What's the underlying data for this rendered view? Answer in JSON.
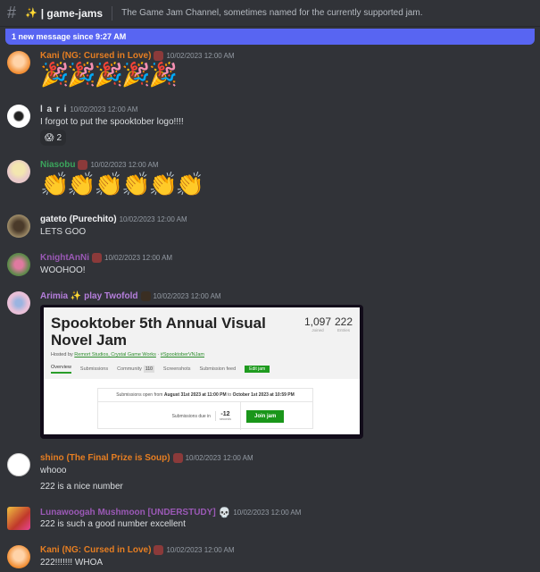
{
  "channel": {
    "name": "| game-jams",
    "topic": "The Game Jam Channel, sometimes named for the currently supported jam."
  },
  "new_messages_bar": "1 new message since 9:27 AM",
  "messages": [
    {
      "username": "Kani (NG: Cursed in Love)",
      "color": "#e67e22",
      "timestamp": "10/02/2023 12:00 AM",
      "emoji": "🎉🎉🎉🎉🎉",
      "avatar_color": "#f5a24a"
    },
    {
      "username": "l a r i",
      "color": "#dbdee1",
      "timestamp": "10/02/2023 12:00 AM",
      "text": "I forgot to put the spooktober logo!!!!",
      "reaction": {
        "emoji": "😱",
        "count": "2"
      },
      "avatar_color": "#eeeeee"
    },
    {
      "username": "Niasobu",
      "color": "#3ba55c",
      "timestamp": "10/02/2023 12:00 AM",
      "emoji": "👏👏👏👏👏👏",
      "avatar_color": "#d9c9c2"
    },
    {
      "username": "gateto (Purechito)",
      "color": "#dbdee1",
      "timestamp": "10/02/2023 12:00 AM",
      "text": "LETS GOO",
      "avatar_color": "#6b5b45"
    },
    {
      "username": "KnightAnNi",
      "color": "#9b59b6",
      "timestamp": "10/02/2023 12:00 AM",
      "text": "WOOHOO!",
      "avatar_color": "#7a9a6a"
    },
    {
      "username": "Arimia ✨ play Twofold",
      "color": "#b57edc",
      "timestamp": "10/02/2023 12:00 AM",
      "avatar_color": "#d8b8d8"
    },
    {
      "username": "shino (The Final Prize is Soup)",
      "color": "#e67e22",
      "timestamp": "10/02/2023 12:00 AM",
      "lines": [
        "whooo",
        "222 is a nice number"
      ],
      "avatar_color": "#ffffff"
    },
    {
      "username": "Lunawoogah Mushmoon [UNDERSTUDY]",
      "color": "#9b59b6",
      "timestamp": "10/02/2023 12:00 AM",
      "text": "222 is such a good number excellent",
      "avatar_color": "#c0392b"
    },
    {
      "username": "Kani (NG: Cursed in Love)",
      "color": "#e67e22",
      "timestamp": "10/02/2023 12:00 AM",
      "text": "222!!!!!!! WHOA",
      "avatar_color": "#f5a24a"
    }
  ],
  "embed": {
    "title": "Spooktober 5th Annual Visual Novel Jam",
    "hosted_by_prefix": "Hosted by ",
    "hosts": "Remort Studios, Crystal Game Works",
    "hashtag": "#SpooktoberVNJam",
    "joined": "1,097",
    "joined_label": "Joined",
    "entries": "222",
    "entries_label": "Entries",
    "tabs": [
      "Overview",
      "Submissions",
      "Community",
      "Screenshots",
      "Submission feed"
    ],
    "community_count": "110",
    "edit_jam": "Edit jam",
    "open_prefix": "Submissions open from ",
    "open_start": "August 31st 2023 at 11:00 PM",
    "open_mid": " to ",
    "open_end": "October 1st 2023 at 10:59 PM",
    "due_label": "Submissions due in",
    "countdown_value": "-12",
    "countdown_unit": "seconds",
    "join_button": "Join jam"
  }
}
